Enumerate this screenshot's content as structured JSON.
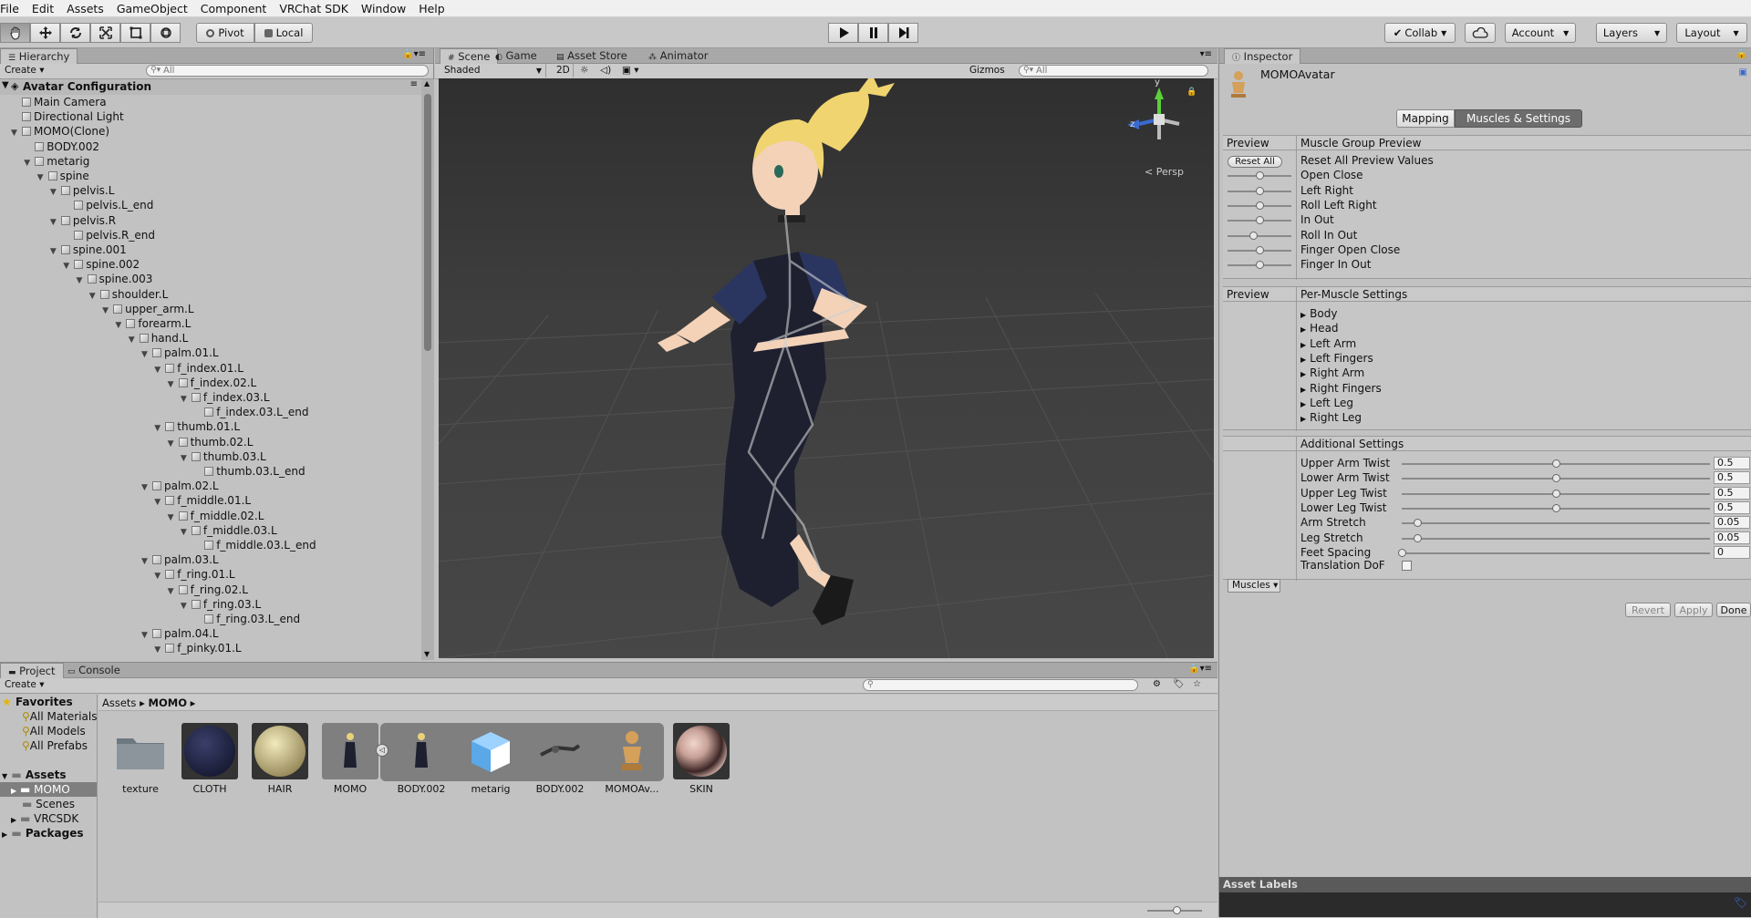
{
  "menu": [
    "File",
    "Edit",
    "Assets",
    "GameObject",
    "Component",
    "VRChat SDK",
    "Window",
    "Help"
  ],
  "toolbar": {
    "pivot": "Pivot",
    "local": "Local",
    "collab": "Collab",
    "account": "Account",
    "layers": "Layers",
    "layout": "Layout"
  },
  "hierarchy": {
    "tab": "Hierarchy",
    "create": "Create",
    "search_placeholder": "All",
    "scene_name": "Avatar Configuration",
    "rows": [
      {
        "label": "Main Camera",
        "depth": 1,
        "arrow": false
      },
      {
        "label": "Directional Light",
        "depth": 1,
        "arrow": false
      },
      {
        "label": "MOMO(Clone)",
        "depth": 1,
        "arrow": true
      },
      {
        "label": "BODY.002",
        "depth": 2,
        "arrow": false
      },
      {
        "label": "metarig",
        "depth": 2,
        "arrow": true
      },
      {
        "label": "spine",
        "depth": 3,
        "arrow": true
      },
      {
        "label": "pelvis.L",
        "depth": 4,
        "arrow": true
      },
      {
        "label": "pelvis.L_end",
        "depth": 5,
        "arrow": false
      },
      {
        "label": "pelvis.R",
        "depth": 4,
        "arrow": true
      },
      {
        "label": "pelvis.R_end",
        "depth": 5,
        "arrow": false
      },
      {
        "label": "spine.001",
        "depth": 4,
        "arrow": true
      },
      {
        "label": "spine.002",
        "depth": 5,
        "arrow": true
      },
      {
        "label": "spine.003",
        "depth": 6,
        "arrow": true
      },
      {
        "label": "shoulder.L",
        "depth": 7,
        "arrow": true
      },
      {
        "label": "upper_arm.L",
        "depth": 8,
        "arrow": true
      },
      {
        "label": "forearm.L",
        "depth": 9,
        "arrow": true
      },
      {
        "label": "hand.L",
        "depth": 10,
        "arrow": true
      },
      {
        "label": "palm.01.L",
        "depth": 11,
        "arrow": true
      },
      {
        "label": "f_index.01.L",
        "depth": 12,
        "arrow": true
      },
      {
        "label": "f_index.02.L",
        "depth": 13,
        "arrow": true
      },
      {
        "label": "f_index.03.L",
        "depth": 14,
        "arrow": true
      },
      {
        "label": "f_index.03.L_end",
        "depth": 15,
        "arrow": false
      },
      {
        "label": "thumb.01.L",
        "depth": 12,
        "arrow": true
      },
      {
        "label": "thumb.02.L",
        "depth": 13,
        "arrow": true
      },
      {
        "label": "thumb.03.L",
        "depth": 14,
        "arrow": true
      },
      {
        "label": "thumb.03.L_end",
        "depth": 15,
        "arrow": false
      },
      {
        "label": "palm.02.L",
        "depth": 11,
        "arrow": true
      },
      {
        "label": "f_middle.01.L",
        "depth": 12,
        "arrow": true
      },
      {
        "label": "f_middle.02.L",
        "depth": 13,
        "arrow": true
      },
      {
        "label": "f_middle.03.L",
        "depth": 14,
        "arrow": true
      },
      {
        "label": "f_middle.03.L_end",
        "depth": 15,
        "arrow": false
      },
      {
        "label": "palm.03.L",
        "depth": 11,
        "arrow": true
      },
      {
        "label": "f_ring.01.L",
        "depth": 12,
        "arrow": true
      },
      {
        "label": "f_ring.02.L",
        "depth": 13,
        "arrow": true
      },
      {
        "label": "f_ring.03.L",
        "depth": 14,
        "arrow": true
      },
      {
        "label": "f_ring.03.L_end",
        "depth": 15,
        "arrow": false
      },
      {
        "label": "palm.04.L",
        "depth": 11,
        "arrow": true
      },
      {
        "label": "f_pinky.01.L",
        "depth": 12,
        "arrow": true
      }
    ]
  },
  "scene": {
    "tabs": [
      "Scene",
      "Game",
      "Asset Store",
      "Animator"
    ],
    "shading": "Shaded",
    "mode_2d": "2D",
    "gizmos": "Gizmos",
    "search_placeholder": "All",
    "persp": "Persp",
    "axis_y": "y",
    "axis_z": "z"
  },
  "inspector": {
    "tab": "Inspector",
    "object": "MOMOAvatar",
    "tabs": [
      "Mapping",
      "Muscles & Settings"
    ],
    "muscle_group": {
      "preview": "Preview",
      "header": "Muscle Group Preview",
      "reset": "Reset All",
      "rows": [
        {
          "label": "Reset All Preview Values"
        },
        {
          "label": "Open Close",
          "value": 0.5
        },
        {
          "label": "Left Right",
          "value": 0.5
        },
        {
          "label": "Roll Left Right",
          "value": 0.5
        },
        {
          "label": "In Out",
          "value": 0.5
        },
        {
          "label": "Roll In Out",
          "value": 0.4
        },
        {
          "label": "Finger Open Close",
          "value": 0.5
        },
        {
          "label": "Finger In Out",
          "value": 0.5
        }
      ]
    },
    "per_muscle": {
      "preview": "Preview",
      "header": "Per-Muscle Settings",
      "items": [
        "Body",
        "Head",
        "Left Arm",
        "Left Fingers",
        "Right Arm",
        "Right Fingers",
        "Left Leg",
        "Right Leg"
      ]
    },
    "additional": {
      "header": "Additional Settings",
      "rows": [
        {
          "label": "Upper Arm Twist",
          "value": "0.5",
          "fraction": 0.5
        },
        {
          "label": "Lower Arm Twist",
          "value": "0.5",
          "fraction": 0.5
        },
        {
          "label": "Upper Leg Twist",
          "value": "0.5",
          "fraction": 0.5
        },
        {
          "label": "Lower Leg Twist",
          "value": "0.5",
          "fraction": 0.5
        },
        {
          "label": "Arm Stretch",
          "value": "0.05",
          "fraction": 0.05
        },
        {
          "label": "Leg Stretch",
          "value": "0.05",
          "fraction": 0.05
        },
        {
          "label": "Feet Spacing",
          "value": "0",
          "fraction": 0
        }
      ],
      "translation_dof": "Translation DoF"
    },
    "muscles_dropdown": "Muscles",
    "revert": "Revert",
    "apply": "Apply",
    "done": "Done",
    "asset_labels": "Asset Labels"
  },
  "project": {
    "tabs": [
      "Project",
      "Console"
    ],
    "create": "Create",
    "favorites": "Favorites",
    "fav_items": [
      "All Materials",
      "All Models",
      "All Prefabs"
    ],
    "assets": "Assets",
    "asset_folders": [
      "MOMO",
      "Scenes",
      "VRCSDK"
    ],
    "packages": "Packages",
    "breadcrumb": [
      "Assets",
      "MOMO"
    ],
    "items": [
      "texture",
      "CLOTH",
      "HAIR",
      "MOMO",
      "BODY.002",
      "metarig",
      "BODY.002",
      "MOMOAv...",
      "SKIN"
    ]
  }
}
